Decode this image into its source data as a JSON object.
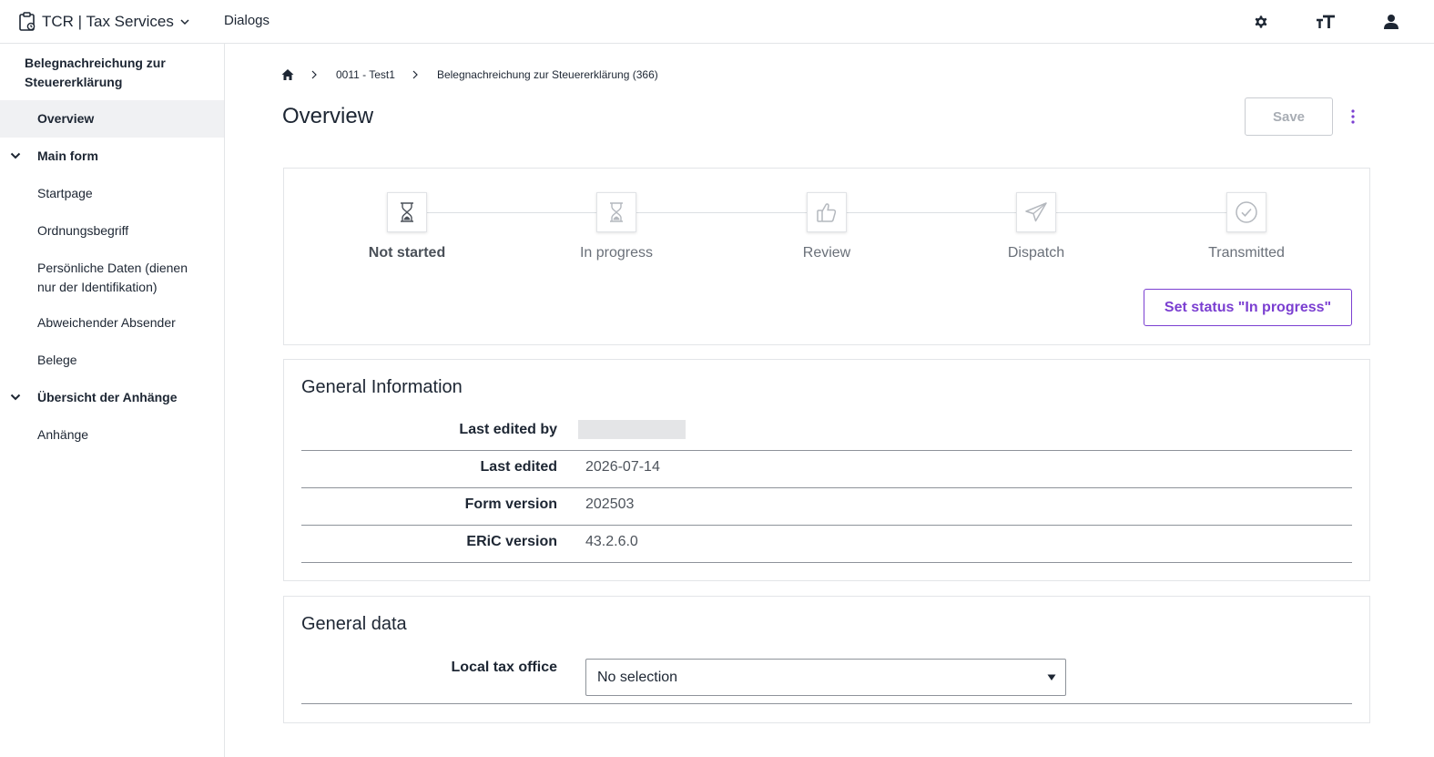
{
  "app": {
    "title": "TCR | Tax Services",
    "nav_link": "Dialogs"
  },
  "sidebar": {
    "title": "Belegnachreichung zur Steuererklärung",
    "items": [
      {
        "label": "Overview"
      },
      {
        "label": "Main form"
      },
      {
        "label": "Startpage"
      },
      {
        "label": "Ordnungsbegriff"
      },
      {
        "label": "Persönliche Daten (dienen nur der Identifikation)"
      },
      {
        "label": "Abweichender Absender"
      },
      {
        "label": "Belege"
      },
      {
        "label": "Übersicht der Anhänge"
      },
      {
        "label": "Anhänge"
      }
    ]
  },
  "breadcrumb": {
    "items": [
      "0011 - Test1",
      "Belegnachreichung zur Steuererklärung (366)"
    ]
  },
  "page": {
    "title": "Overview",
    "save_label": "Save"
  },
  "status": {
    "steps": [
      {
        "label": "Not started",
        "icon": "hourglass-icon"
      },
      {
        "label": "In progress",
        "icon": "hourglass-icon"
      },
      {
        "label": "Review",
        "icon": "thumbs-up-icon"
      },
      {
        "label": "Dispatch",
        "icon": "paper-plane-icon"
      },
      {
        "label": "Transmitted",
        "icon": "check-circle-icon"
      }
    ],
    "action_label": "Set status \"In progress\""
  },
  "general_information": {
    "title": "General Information",
    "rows": [
      {
        "label": "Last edited by",
        "value": ""
      },
      {
        "label": "Last edited",
        "value": "2026-07-14"
      },
      {
        "label": "Form version",
        "value": "202503"
      },
      {
        "label": "ERiC version",
        "value": "43.2.6.0"
      }
    ]
  },
  "general_data": {
    "title": "General data",
    "local_tax_office_label": "Local tax office",
    "local_tax_office_value": "No selection"
  },
  "colors": {
    "accent": "#7b3fd1",
    "text": "#1d2633",
    "border": "#e3e5e8"
  }
}
